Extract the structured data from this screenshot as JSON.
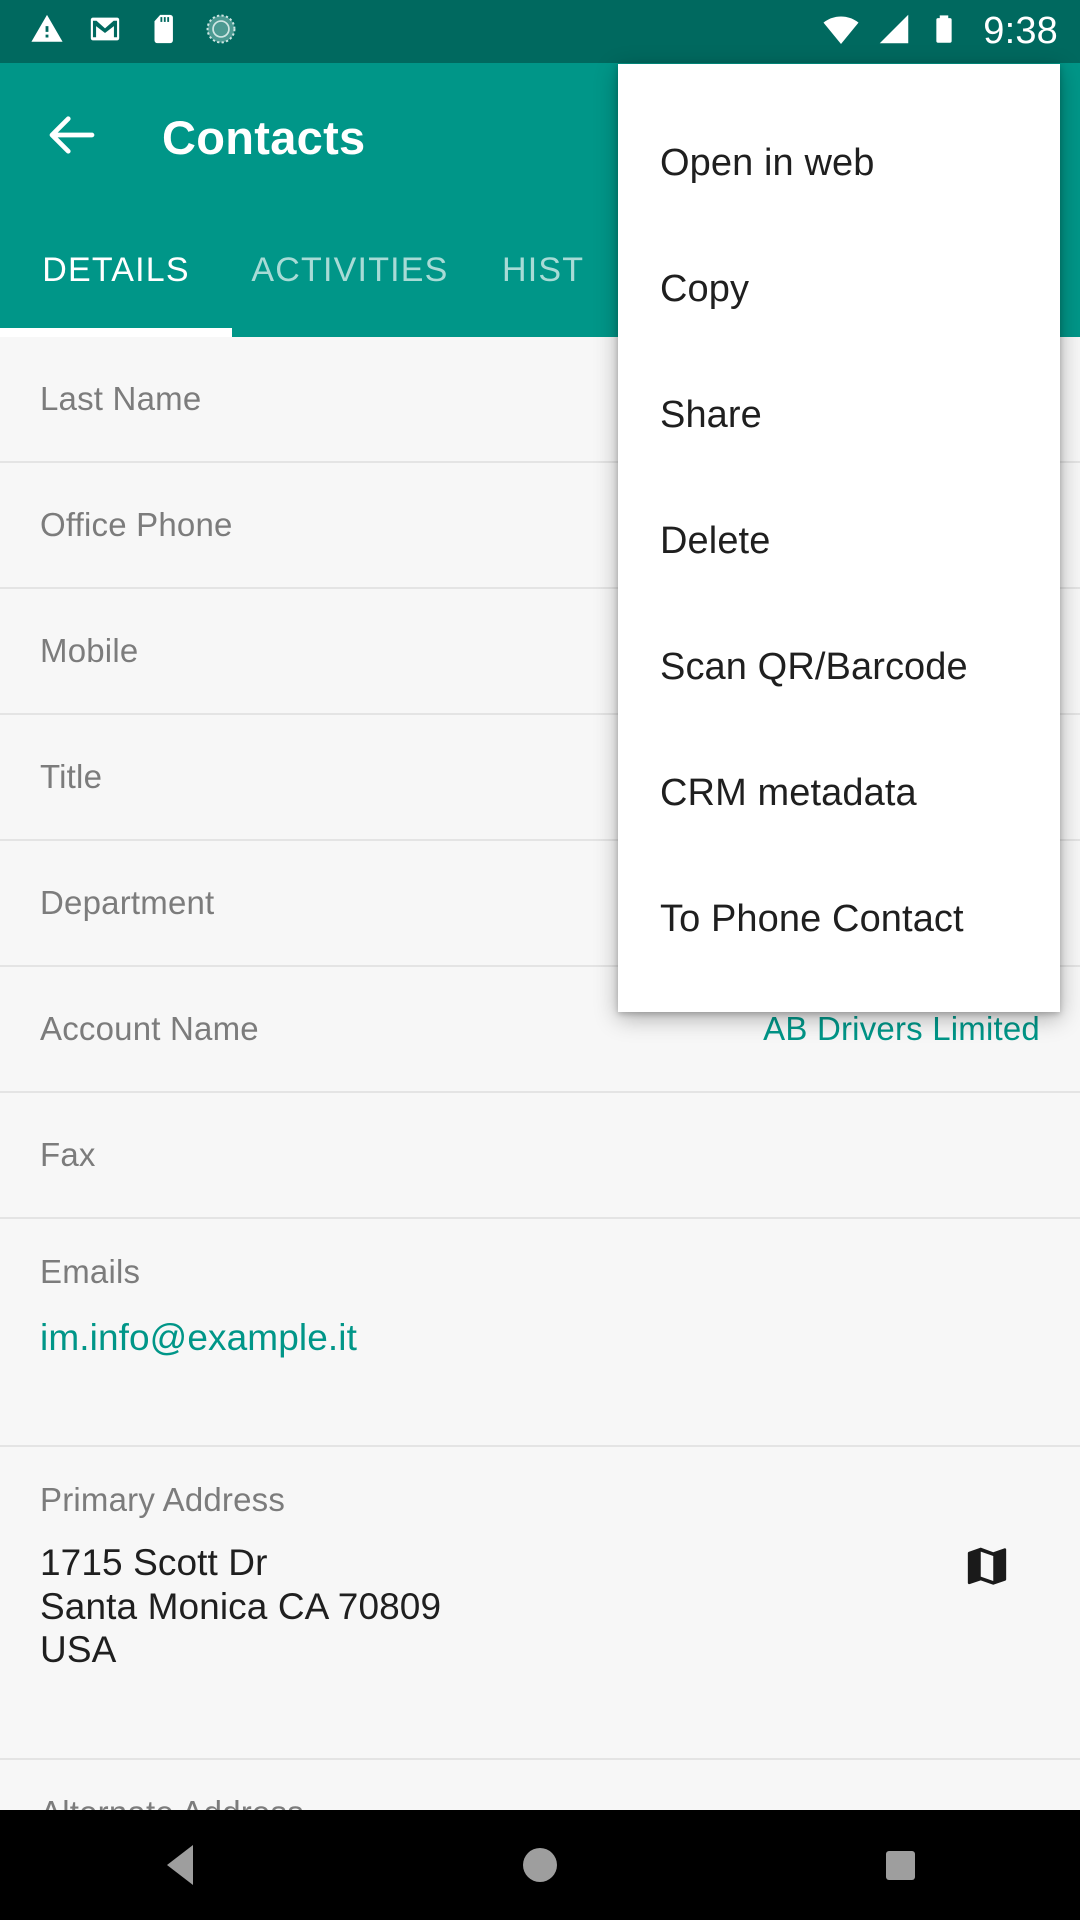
{
  "status_bar": {
    "time": "9:38",
    "left_icons": [
      "warning-icon",
      "gmail-icon",
      "sd-card-icon",
      "sync-circle-icon"
    ],
    "right_icons": [
      "wifi-icon",
      "cellular-signal-icon",
      "battery-icon"
    ],
    "background_color": "#00695f"
  },
  "app_bar": {
    "back_icon": "back-arrow-icon",
    "title": "Contacts",
    "background_color": "#009688"
  },
  "tabs": {
    "items": [
      {
        "label": "DETAILS",
        "active": true
      },
      {
        "label": "ACTIVITIES",
        "active": false
      },
      {
        "label": "HIST",
        "active": false
      }
    ],
    "indicator_color": "#ffffff"
  },
  "details": {
    "rows": [
      {
        "label": "Last Name",
        "value": ""
      },
      {
        "label": "Office Phone",
        "value": ""
      },
      {
        "label": "Mobile",
        "value": ""
      },
      {
        "label": "Title",
        "value": ""
      },
      {
        "label": "Department",
        "value": ""
      },
      {
        "label": "Account Name",
        "value": "AB Drivers Limited"
      },
      {
        "label": "Fax",
        "value": ""
      }
    ],
    "emails": {
      "label": "Emails",
      "value": "im.info@example.it"
    },
    "primary_address": {
      "label": "Primary Address",
      "line1": "1715 Scott Dr",
      "line2": "Santa Monica CA 70809",
      "line3": "USA",
      "map_icon": "map-icon"
    },
    "alternate_address": {
      "label": "Alternate Address"
    },
    "link_color": "#009688",
    "label_color": "#7c7c7c"
  },
  "overflow_menu": {
    "items": [
      {
        "label": "Open in web"
      },
      {
        "label": "Copy"
      },
      {
        "label": "Share"
      },
      {
        "label": "Delete"
      },
      {
        "label": "Scan QR/Barcode"
      },
      {
        "label": "CRM metadata"
      },
      {
        "label": "To Phone Contact"
      }
    ],
    "background_color": "#ffffff"
  },
  "nav_bar": {
    "back_label": "back-triangle-icon",
    "home_label": "home-circle-icon",
    "recents_label": "recents-square-icon",
    "background_color": "#000000"
  }
}
